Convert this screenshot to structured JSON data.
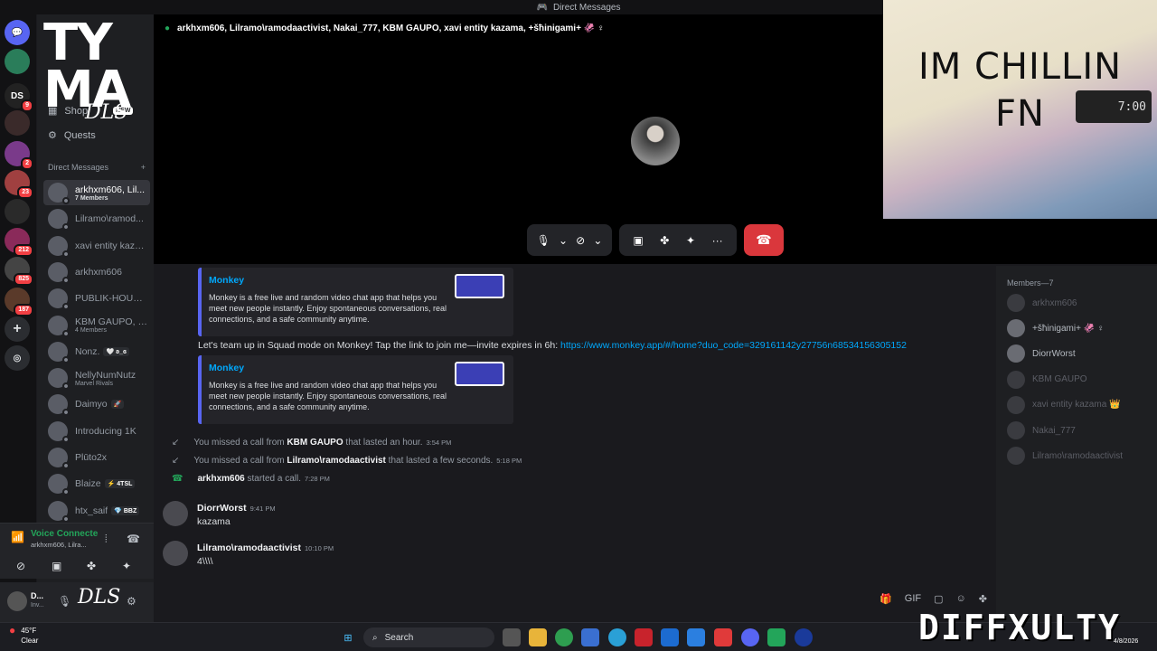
{
  "window": {
    "title": "Direct Messages"
  },
  "guilds": [
    {
      "badge": "",
      "color": "#5865f2"
    },
    {
      "badge": "",
      "color": "#2a7d5a"
    },
    {
      "badge": "9",
      "color": "#222"
    },
    {
      "badge": "",
      "color": "#3a2a2a"
    },
    {
      "badge": "2",
      "color": "#7a3a8a"
    },
    {
      "badge": "23",
      "color": "#a04040"
    },
    {
      "badge": "",
      "color": "#2a2a2a"
    },
    {
      "badge": "212",
      "color": "#8a2a5a"
    },
    {
      "badge": "825",
      "color": "#444"
    },
    {
      "badge": "187",
      "color": "#5a3a2a"
    }
  ],
  "sidebar": {
    "shop_label": "Shop",
    "shop_badge": "NEW",
    "quests_label": "Quests",
    "dm_header": "Direct Messages",
    "dms": [
      {
        "name": "arkhxm606, Lil...",
        "sub": "7 Members",
        "active": true
      },
      {
        "name": "Lilramo\\ramod...",
        "sub": ""
      },
      {
        "name": "xavi entity kaza...",
        "sub": ""
      },
      {
        "name": "arkhxm606",
        "sub": ""
      },
      {
        "name": "PUBLIK-HOUSI...",
        "sub": ""
      },
      {
        "name": "KBM GAUPO, L...",
        "sub": "4 Members"
      },
      {
        "name": "Nonz.",
        "sub": "",
        "tag": "🤍 ʚ_ɞ"
      },
      {
        "name": "NellyNumNutz",
        "sub": "Marvel Rivals"
      },
      {
        "name": "Daimyo",
        "sub": "",
        "tag": "🚀"
      },
      {
        "name": "Introducing 1K",
        "sub": ""
      },
      {
        "name": "Plūto2x",
        "sub": ""
      },
      {
        "name": "Blaize",
        "sub": "",
        "tag": "⚡ 4TSL"
      },
      {
        "name": "htx_saif",
        "sub": "",
        "tag": "💎 BBZ"
      }
    ]
  },
  "voice": {
    "status": "Voice Connecte",
    "channel": "arkhxm606, Lilra..."
  },
  "user": {
    "name": "D...",
    "sub": "Inv..."
  },
  "call": {
    "title": "arkhxm606, Lilramo\\ramodaactivist, Nakai_777, KBM GAUPO, xavi entity kazama, +šħinigami+ 🦑 ♀"
  },
  "overlay": {
    "caption_line1": "IM CHILLIN",
    "caption_line2": "FN",
    "clock": "7:00",
    "logo_line1": "TY",
    "logo_line2": "MA",
    "dls": "DLS",
    "watermark": "DIFFXULTY"
  },
  "chat": {
    "embed1": {
      "title": "Monkey",
      "desc": "Monkey is a free live and random video chat app that helps you meet new people instantly. Enjoy spontaneous conversations, real connections, and a safe community anytime."
    },
    "invite_text": "Let's team up in Squad mode on Monkey! Tap the link to join me—invite expires in 6h: ",
    "invite_link": "https://www.monkey.app/#/home?duo_code=329161142y27756n68534156305152",
    "embed2": {
      "title": "Monkey",
      "desc": "Monkey is a free live and random video chat app that helps you meet new people instantly. Enjoy spontaneous conversations, real connections, and a safe community anytime."
    },
    "sys1": {
      "pre": "You missed a call from ",
      "who": "KBM GAUPO",
      "post": " that lasted an hour.",
      "ts": "3:54 PM"
    },
    "sys2": {
      "pre": "You missed a call from ",
      "who": "Lilramo\\ramodaactivist",
      "post": " that lasted a few seconds.",
      "ts": "5:18 PM"
    },
    "sys3": {
      "who": "arkhxm606",
      "post": " started a call.",
      "ts": "7:28 PM"
    },
    "msg1": {
      "author": "DiorrWorst",
      "ts": "9:41 PM",
      "body": "kazama"
    },
    "msg2": {
      "author": "Lilramo\\ramodaactivist",
      "ts": "10:10 PM",
      "body": "4\\\\\\\\"
    }
  },
  "members": {
    "header": "Members—7",
    "list": [
      {
        "name": "arkhxm606",
        "online": false
      },
      {
        "name": "+šħinigami+ 🦑 ♀",
        "online": true
      },
      {
        "name": "DiorrWorst",
        "online": true
      },
      {
        "name": "KBM GAUPO",
        "online": false
      },
      {
        "name": "xavi entity kazama 👑",
        "online": false
      },
      {
        "name": "Nakai_777",
        "online": false
      },
      {
        "name": "Lilramo\\ramodaactivist",
        "online": false
      }
    ]
  },
  "taskbar": {
    "weather_temp": "45°F",
    "weather_desc": "Clear",
    "search_label": "Search",
    "date": "4/8/2026"
  },
  "colors": {
    "accent": "#5865f2",
    "link": "#00a8fc",
    "danger": "#da373c",
    "online": "#23a55a"
  }
}
